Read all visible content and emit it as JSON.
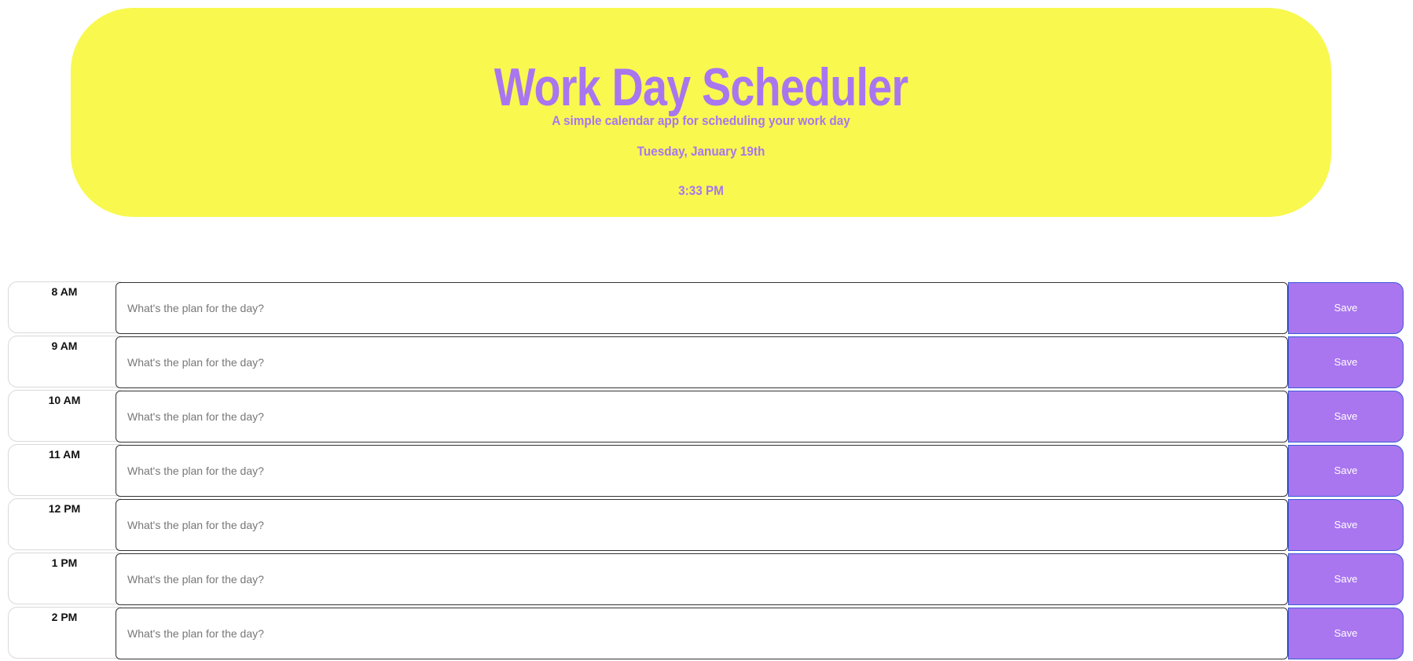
{
  "header": {
    "title": "Work Day Scheduler",
    "subtitle": "A simple calendar app for scheduling your work day",
    "date": "Tuesday, January 19th",
    "time": "3:33 PM"
  },
  "timeblocks": [
    {
      "hour": "8 AM",
      "placeholder": "What's the plan for the day?",
      "value": "",
      "save_label": "Save"
    },
    {
      "hour": "9 AM",
      "placeholder": "What's the plan for the day?",
      "value": "",
      "save_label": "Save"
    },
    {
      "hour": "10 AM",
      "placeholder": "What's the plan for the day?",
      "value": "",
      "save_label": "Save"
    },
    {
      "hour": "11 AM",
      "placeholder": "What's the plan for the day?",
      "value": "",
      "save_label": "Save"
    },
    {
      "hour": "12 PM",
      "placeholder": "What's the plan for the day?",
      "value": "",
      "save_label": "Save"
    },
    {
      "hour": "1 PM",
      "placeholder": "What's the plan for the day?",
      "value": "",
      "save_label": "Save"
    },
    {
      "hour": "2 PM",
      "placeholder": "What's the plan for the day?",
      "value": "",
      "save_label": "Save"
    }
  ],
  "colors": {
    "header_background": "#f8f84f",
    "accent": "#a976ef",
    "save_border": "#3d5bd9"
  }
}
